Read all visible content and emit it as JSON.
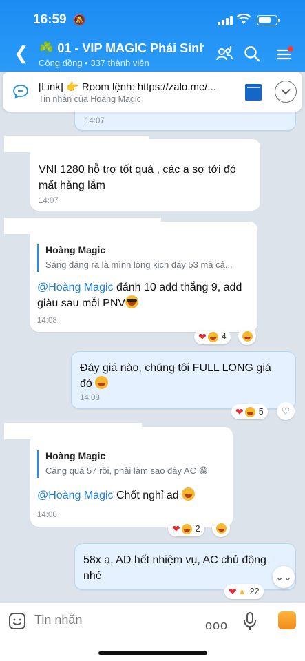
{
  "status": {
    "time": "16:59"
  },
  "header": {
    "title": "☘️ 01 - VIP MAGIC Phái Sinh",
    "subtitle": "Cộng đồng • 337 thành viên"
  },
  "pinned": {
    "title": "[Link] 👉 Room lệnh: https://zalo.me/...",
    "subtitle": "Tin nhắn của Hoàng Magic"
  },
  "messages": {
    "m0": {
      "time": "14:07"
    },
    "m1": {
      "text": "VNI 1280 hỗ trợ tốt quá , các a sợ tới đó mất hàng lắm",
      "time": "14:07"
    },
    "m2": {
      "quote_author": "Hoàng Magic",
      "quote_text": "Sáng đáng ra là mình long kịch đáy 53 mà cả...",
      "mention": "@Hoàng Magic",
      "text": " đánh 10 add thắng 9, add giàu sau mỗi PNV",
      "time": "14:08",
      "reaction_count": "4"
    },
    "m3": {
      "text": "Đáy giá nào, chúng tôi FULL LONG giá đó ",
      "time": "14:08",
      "reaction_count": "5"
    },
    "m4": {
      "quote_author": "Hoàng Magic",
      "quote_text": "Căng quá 57 rồi, phải làm sao đây AC 😁",
      "mention": "@Hoàng Magic",
      "text": " Chốt nghỉ ad ",
      "time": "14:08",
      "reaction_count": "2"
    },
    "m5": {
      "text": "58x ạ, AD hết nhiệm vụ, AC chủ động nhé",
      "reaction_count": "22"
    }
  },
  "input": {
    "placeholder": "Tin nhắn"
  },
  "colors": {
    "header": "#1b8cf2",
    "mine_bubble": "#e5f1ff",
    "mention": "#1c7ed6"
  }
}
